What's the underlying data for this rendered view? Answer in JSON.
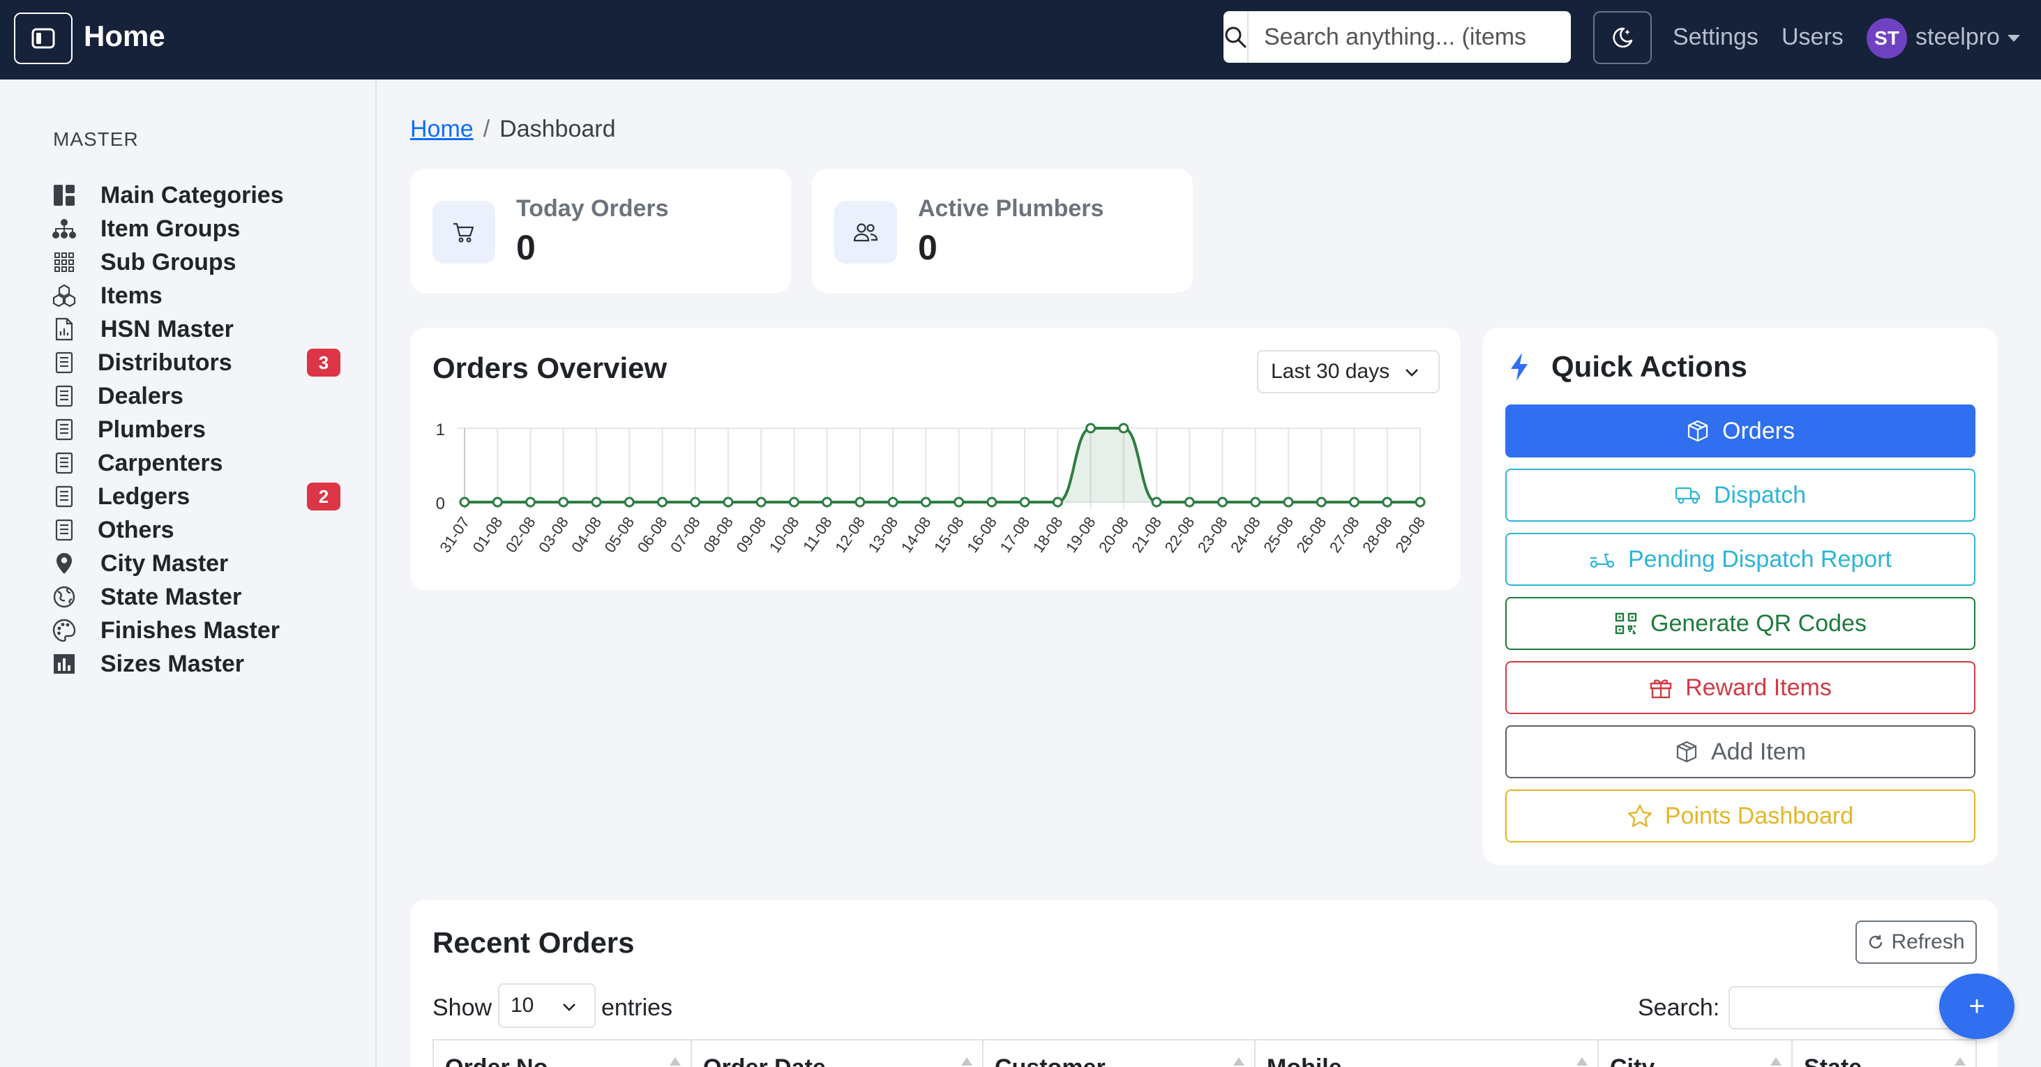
{
  "header": {
    "title": "Home",
    "search_placeholder": "Search anything... (items",
    "links": {
      "settings": "Settings",
      "users": "Users"
    },
    "user": {
      "initials": "ST",
      "name": "steelpro"
    }
  },
  "sidebar": {
    "heading": "MASTER",
    "items": [
      {
        "label": "Main Categories",
        "icon": "dashboard-icon"
      },
      {
        "label": "Item Groups",
        "icon": "sitemap-icon"
      },
      {
        "label": "Sub Groups",
        "icon": "grid-icon"
      },
      {
        "label": "Items",
        "icon": "cubes-icon"
      },
      {
        "label": "HSN Master",
        "icon": "file-chart-icon"
      },
      {
        "label": "Distributors",
        "icon": "document-icon",
        "badge": "3"
      },
      {
        "label": "Dealers",
        "icon": "document-icon"
      },
      {
        "label": "Plumbers",
        "icon": "document-icon"
      },
      {
        "label": "Carpenters",
        "icon": "document-icon"
      },
      {
        "label": "Ledgers",
        "icon": "document-icon",
        "badge": "2"
      },
      {
        "label": "Others",
        "icon": "document-icon"
      },
      {
        "label": "City Master",
        "icon": "map-pin-icon"
      },
      {
        "label": "State Master",
        "icon": "globe-icon"
      },
      {
        "label": "Finishes Master",
        "icon": "palette-icon"
      },
      {
        "label": "Sizes Master",
        "icon": "chart-icon"
      }
    ]
  },
  "breadcrumb": {
    "home": "Home",
    "separator": "/",
    "current": "Dashboard"
  },
  "stats": [
    {
      "label": "Today Orders",
      "value": "0",
      "icon": "cart-icon"
    },
    {
      "label": "Active Plumbers",
      "value": "0",
      "icon": "users-icon"
    }
  ],
  "orders_overview": {
    "title": "Orders Overview",
    "period": "Last 30 days"
  },
  "chart_data": {
    "type": "area",
    "x": [
      "31-07",
      "01-08",
      "02-08",
      "03-08",
      "04-08",
      "05-08",
      "06-08",
      "07-08",
      "08-08",
      "09-08",
      "10-08",
      "11-08",
      "12-08",
      "13-08",
      "14-08",
      "15-08",
      "16-08",
      "17-08",
      "18-08",
      "19-08",
      "20-08",
      "21-08",
      "22-08",
      "23-08",
      "24-08",
      "25-08",
      "26-08",
      "27-08",
      "28-08",
      "29-08"
    ],
    "series": [
      {
        "values": [
          0,
          0,
          0,
          0,
          0,
          0,
          0,
          0,
          0,
          0,
          0,
          0,
          0,
          0,
          0,
          0,
          0,
          0,
          0,
          1,
          1,
          0,
          0,
          0,
          0,
          0,
          0,
          0,
          0,
          0
        ]
      }
    ],
    "yticks": [
      "0",
      "1"
    ],
    "ylim": [
      0,
      1
    ],
    "grid": true,
    "color": "#2e7d42"
  },
  "quick_actions": {
    "title": "Quick Actions",
    "buttons": [
      {
        "label": "Orders",
        "icon": "box-icon",
        "color": "#2f6ff0",
        "filled": true
      },
      {
        "label": "Dispatch",
        "icon": "truck-icon",
        "color": "#2cb5d6"
      },
      {
        "label": "Pending Dispatch Report",
        "icon": "scooter-icon",
        "color": "#2cb5d6"
      },
      {
        "label": "Generate QR Codes",
        "icon": "qr-code-icon",
        "color": "#1e7b3c"
      },
      {
        "label": "Reward Items",
        "icon": "gift-icon",
        "color": "#d13a44"
      },
      {
        "label": "Add Item",
        "icon": "box-icon",
        "color": "#5a6169"
      },
      {
        "label": "Points Dashboard",
        "icon": "star-icon",
        "color": "#e3b626"
      }
    ]
  },
  "recent_orders": {
    "title": "Recent Orders",
    "refresh": "Refresh",
    "show": "Show",
    "entries_value": "10",
    "entries": "entries",
    "search_label": "Search:",
    "columns": [
      "Order No",
      "Order Date",
      "Customer",
      "Mobile",
      "City",
      "State"
    ]
  },
  "fab": {
    "label": "+"
  }
}
